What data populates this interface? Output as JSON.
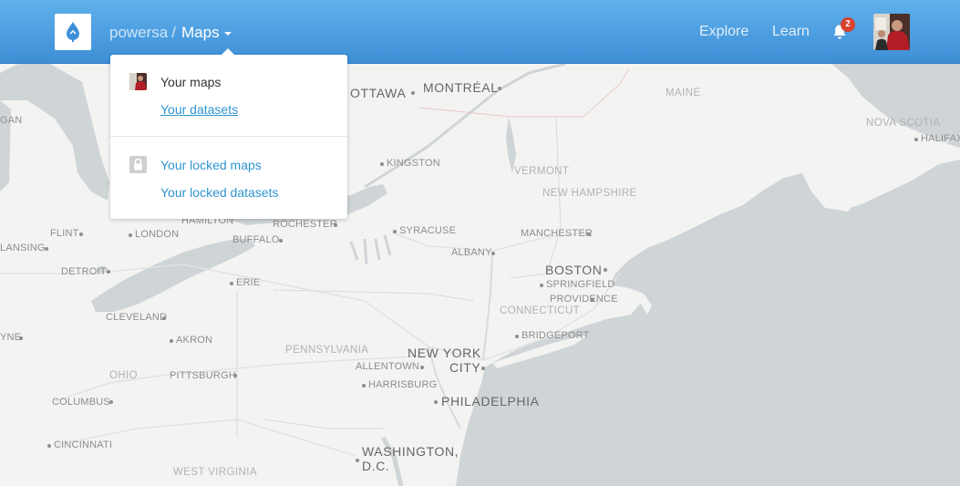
{
  "header": {
    "breadcrumb_user": "powersa",
    "breadcrumb_sep": "/",
    "breadcrumb_current": "Maps",
    "nav_explore": "Explore",
    "nav_learn": "Learn",
    "notification_count": "2",
    "logo_icon": "mapbox-drop-icon",
    "bell_icon": "bell-icon"
  },
  "dropdown": {
    "your_maps": "Your maps",
    "your_datasets": "Your datasets",
    "your_locked_maps": "Your locked maps",
    "your_locked_datasets": "Your locked datasets",
    "lock_icon": "lock-icon"
  },
  "map": {
    "labels": {
      "ottawa": "OTTAWA",
      "montreal": "MONTRÉAL",
      "maine": "MAINE",
      "nova_scotia": "NOVA SCOTIA",
      "halifax": "HALIFAX",
      "kingston": "KINGSTON",
      "vermont": "VERMONT",
      "new_hampshire": "NEW HAMPSHIRE",
      "hamilton": "HAMILTON",
      "rochester": "ROCHESTER",
      "syracuse": "SYRACUSE",
      "manchester": "MANCHESTER",
      "flint": "FLINT",
      "london": "LONDON",
      "buffalo": "BUFFALO",
      "albany": "ALBANY",
      "lansing": "LANSING",
      "boston": "BOSTON",
      "detroit": "DETROIT",
      "erie": "ERIE",
      "springfield": "SPRINGFIELD",
      "providence": "PROVIDENCE",
      "connecticut": "CONNECTICUT",
      "cleveland": "CLEVELAND",
      "bridgeport": "BRIDGEPORT",
      "akron": "AKRON",
      "pennsylvania": "PENNSYLVANIA",
      "new_york_1": "NEW YORK",
      "new_york_2": "CITY",
      "wayne": "YNE",
      "ohio": "OHIO",
      "pittsburgh": "PITTSBURGH",
      "allentown": "ALLENTOWN",
      "harrisburg": "HARRISBURG",
      "columbus": "COLUMBUS",
      "philadelphia": "PHILADELPHIA",
      "cincinnati": "CINCINNATI",
      "washington_1": "WASHINGTON,",
      "washington_2": "D.C.",
      "west_virginia": "WEST VIRGINIA",
      "michigan_edge": "GAN"
    },
    "land_color": "#f3f3f2",
    "water_color": "#cfd4d7"
  },
  "colors": {
    "header_top": "#5fb1ec",
    "header_bottom": "#3e8ed6",
    "link": "#2f94cf",
    "badge": "#d8412f"
  }
}
